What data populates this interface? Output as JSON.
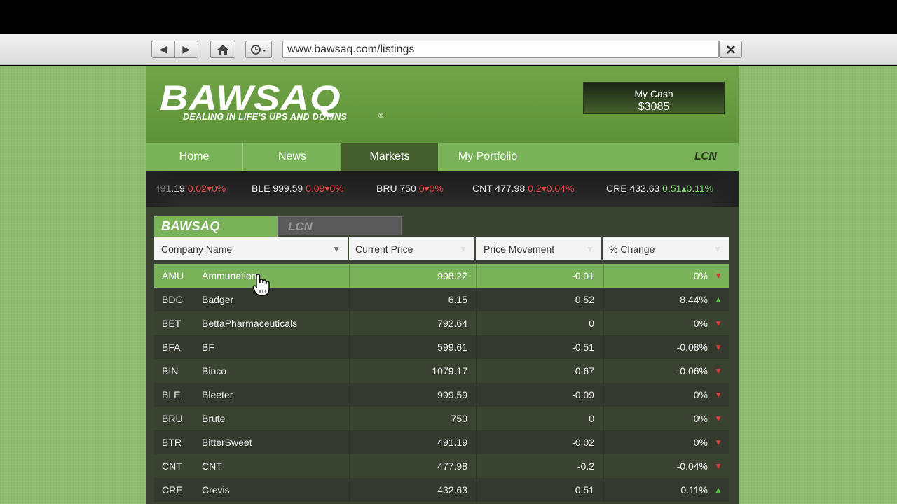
{
  "browser": {
    "url": "www.bawsaq.com/listings",
    "back_icon": "◀",
    "forward_icon": "▶",
    "home_icon": "home-icon",
    "history_icon": "clock-icon",
    "close_icon": "✕"
  },
  "site": {
    "logo": "BAWSAQ",
    "logo_reg": "®",
    "tagline": "DEALING IN LIFE'S UPS AND DOWNS",
    "cash_label": "My Cash",
    "cash_value": "$3085",
    "nav": {
      "home": "Home",
      "news": "News",
      "markets": "Markets",
      "portfolio": "My Portfolio",
      "lcn": "LCN"
    }
  },
  "ticker": [
    {
      "price": "491.19",
      "move": "0.02",
      "pct": "0%",
      "dir": "down"
    },
    {
      "sym": "BLE",
      "price": "999.59",
      "move": "0.09",
      "pct": "0%",
      "dir": "down"
    },
    {
      "sym": "BRU",
      "price": "750",
      "move": "0",
      "pct": "0%",
      "dir": "down"
    },
    {
      "sym": "CNT",
      "price": "477.98",
      "move": "0.2",
      "pct": "0.04%",
      "dir": "down"
    },
    {
      "sym": "CRE",
      "price": "432.63",
      "move": "0.51",
      "pct": "0.11%",
      "dir": "up"
    }
  ],
  "market_tabs": {
    "bawsaq": "BAWSAQ",
    "lcn": "LCN"
  },
  "table": {
    "headers": {
      "name": "Company Name",
      "price": "Current Price",
      "move": "Price Movement",
      "change": "% Change"
    },
    "rows": [
      {
        "sym": "AMU",
        "name": "Ammunation",
        "price": "998.22",
        "move": "-0.01",
        "change": "0%",
        "dir": "down"
      },
      {
        "sym": "BDG",
        "name": "Badger",
        "price": "6.15",
        "move": "0.52",
        "change": "8.44%",
        "dir": "up"
      },
      {
        "sym": "BET",
        "name": "BettaPharmaceuticals",
        "price": "792.64",
        "move": "0",
        "change": "0%",
        "dir": "down"
      },
      {
        "sym": "BFA",
        "name": "BF",
        "price": "599.61",
        "move": "-0.51",
        "change": "-0.08%",
        "dir": "down"
      },
      {
        "sym": "BIN",
        "name": "Binco",
        "price": "1079.17",
        "move": "-0.67",
        "change": "-0.06%",
        "dir": "down"
      },
      {
        "sym": "BLE",
        "name": "Bleeter",
        "price": "999.59",
        "move": "-0.09",
        "change": "0%",
        "dir": "down"
      },
      {
        "sym": "BRU",
        "name": "Brute",
        "price": "750",
        "move": "0",
        "change": "0%",
        "dir": "down"
      },
      {
        "sym": "BTR",
        "name": "BitterSweet",
        "price": "491.19",
        "move": "-0.02",
        "change": "0%",
        "dir": "down"
      },
      {
        "sym": "CNT",
        "name": "CNT",
        "price": "477.98",
        "move": "-0.2",
        "change": "-0.04%",
        "dir": "down"
      },
      {
        "sym": "CRE",
        "name": "Crevis",
        "price": "432.63",
        "move": "0.51",
        "change": "0.11%",
        "dir": "up"
      }
    ]
  },
  "colors": {
    "brand_green": "#7ab25a",
    "dark_green": "#45602e",
    "down_red": "#d63a3a",
    "up_green": "#5cc24a"
  }
}
